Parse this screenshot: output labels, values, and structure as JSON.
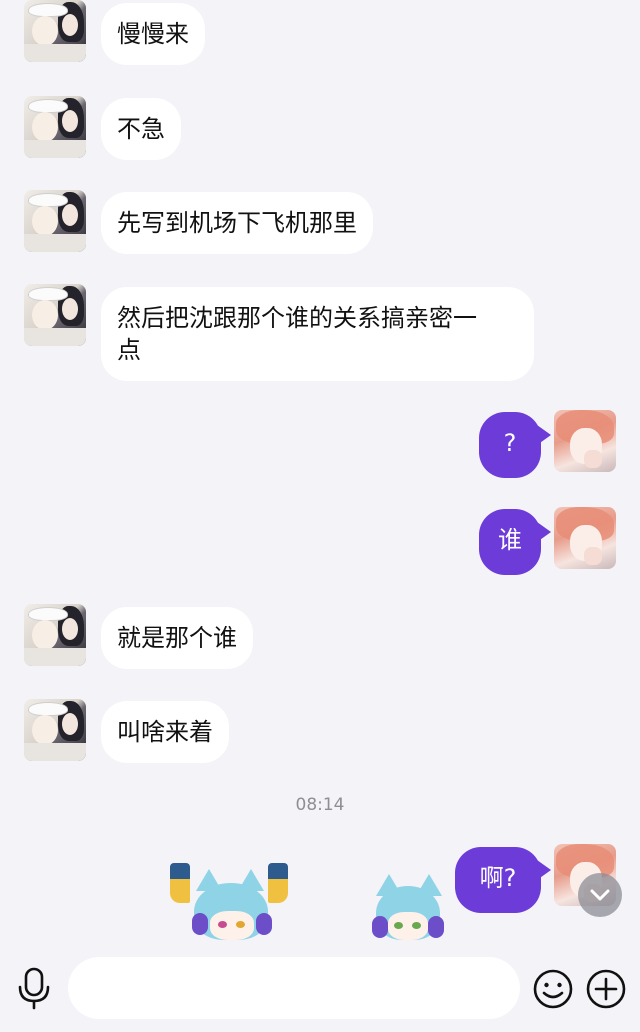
{
  "messages": [
    {
      "side": "in",
      "text": "慢慢来"
    },
    {
      "side": "in",
      "text": "不急"
    },
    {
      "side": "in",
      "text": "先写到机场下飞机那里"
    },
    {
      "side": "in",
      "line1": "然后把沈跟那个谁的关系搞亲密一",
      "line2": "点"
    },
    {
      "side": "out",
      "text": "?"
    },
    {
      "side": "out",
      "text": "谁"
    },
    {
      "side": "in",
      "text": "就是那个谁"
    },
    {
      "side": "in",
      "text": "叫啥来着"
    },
    {
      "side": "out",
      "text": "啊?"
    }
  ],
  "timestamp": "08:14",
  "composer": {
    "placeholder": ""
  },
  "colors": {
    "outgoing_bubble": "#6c3bd8",
    "incoming_bubble": "#ffffff",
    "background": "#f3f3f8"
  },
  "icons": {
    "mic": "microphone-icon",
    "emoji": "smiley-icon",
    "add": "plus-circle-icon",
    "scroll": "chevron-down-icon"
  }
}
